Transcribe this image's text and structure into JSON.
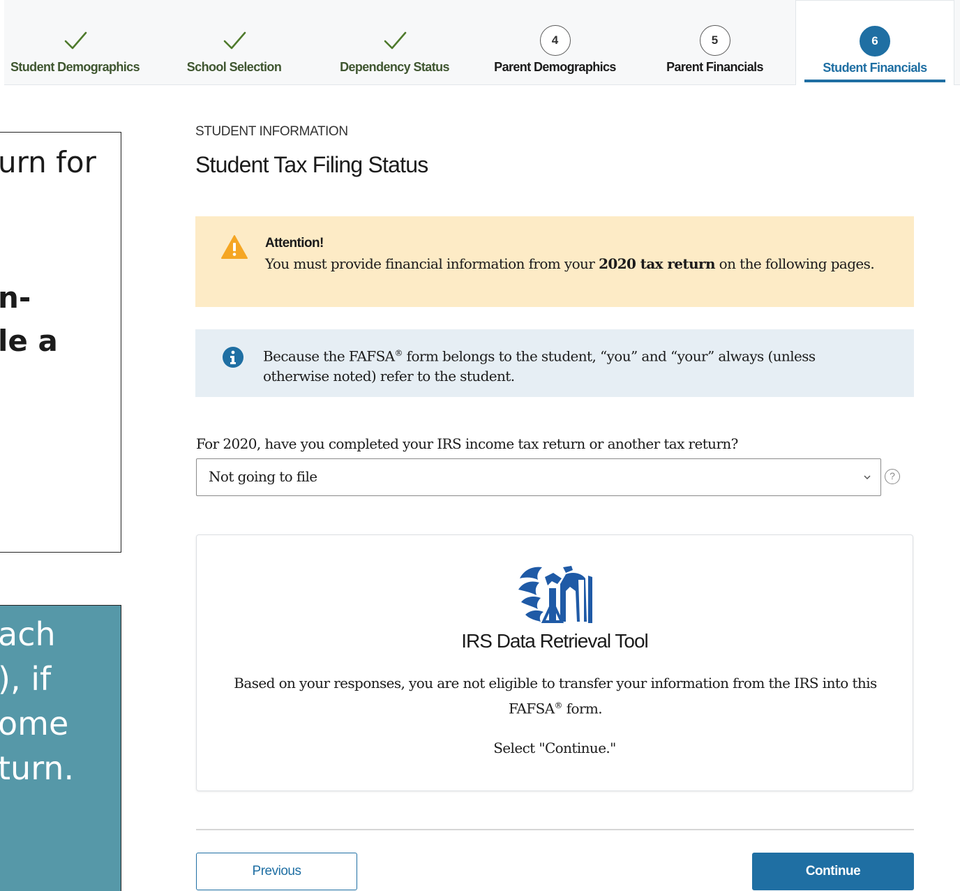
{
  "stepper": {
    "steps": [
      {
        "number": "1",
        "label": "Student Demographics",
        "status": "complete"
      },
      {
        "number": "2",
        "label": "School Selection",
        "status": "complete"
      },
      {
        "number": "3",
        "label": "Dependency Status",
        "status": "complete"
      },
      {
        "number": "4",
        "label": "Parent Demographics",
        "status": "upcoming"
      },
      {
        "number": "5",
        "label": "Parent Financials",
        "status": "upcoming"
      },
      {
        "number": "6",
        "label": "Student Financials",
        "status": "current"
      }
    ]
  },
  "overlay_left_top": {
    "line1": "urn for",
    "line2": "n-",
    "line3": "le a"
  },
  "overlay_left_bottom": {
    "line1": "ach",
    "line2": "), if",
    "line3": "ome",
    "line4": "turn."
  },
  "page": {
    "eyebrow": "STUDENT INFORMATION",
    "title": "Student Tax Filing Status"
  },
  "attention_alert": {
    "heading": "Attention!",
    "text_before": "You must provide financial information from your ",
    "text_bold": "2020 tax return",
    "text_after": " on the following pages.",
    "icon": "warning-triangle-icon"
  },
  "info_alert": {
    "text_before": "Because the FAFSA",
    "registered_mark": "®",
    "text_after": " form belongs to the student, “you” and “your” always (unless otherwise noted) refer to the student.",
    "icon": "info-circle-icon"
  },
  "question": {
    "label": "For 2020, have you completed your IRS income tax return or another tax return?",
    "selected_value": "Not going to file",
    "help_symbol": "?"
  },
  "irs_drt": {
    "title": "IRS Data Retrieval Tool",
    "message_before": "Based on your responses, you are not eligible to transfer your information from the IRS into this FAFSA",
    "registered_mark": "®",
    "message_after": " form.",
    "instruction": "Select \"Continue.\"",
    "logo": "irs-eagle-logo"
  },
  "buttons": {
    "previous": "Previous",
    "continue": "Continue"
  },
  "colors": {
    "primary": "#1f6fa3",
    "check_green": "#4e7a2c",
    "warning_bg": "#fdebc6",
    "warning_icon": "#f5a623",
    "info_bg": "#e6eef4",
    "teal_overlay": "#5698a8",
    "irs_blue": "#1f5aa6"
  }
}
